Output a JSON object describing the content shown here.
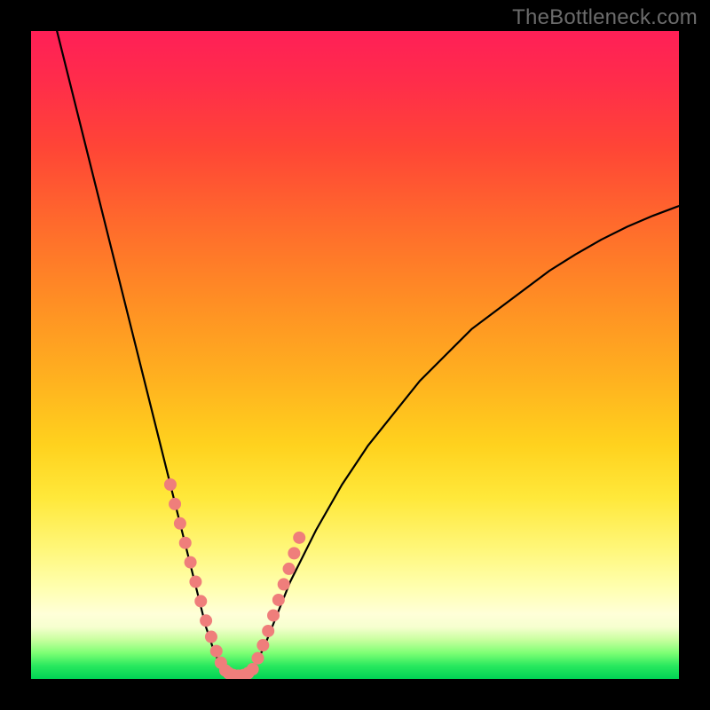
{
  "watermark": {
    "text": "TheBottleneck.com"
  },
  "colors": {
    "curve": "#000000",
    "marker_fill": "#ef7e7b",
    "marker_stroke": "#b24f4e",
    "frame": "#000000"
  },
  "chart_data": {
    "type": "line",
    "title": "",
    "xlabel": "",
    "ylabel": "",
    "xlim": [
      0,
      100
    ],
    "ylim": [
      0,
      100
    ],
    "grid": false,
    "legend": false,
    "series": [
      {
        "name": "bottleneck-curve-left",
        "x": [
          4,
          6,
          8,
          10,
          12,
          14,
          16,
          18,
          20,
          22,
          24,
          26,
          27,
          28,
          29,
          30
        ],
        "y": [
          100,
          92,
          84,
          76,
          68,
          60,
          52,
          44,
          36,
          28,
          20,
          12,
          8,
          5,
          2.5,
          1
        ]
      },
      {
        "name": "bottleneck-curve-floor",
        "x": [
          30,
          31,
          32,
          33,
          34
        ],
        "y": [
          1,
          0.6,
          0.5,
          0.6,
          1
        ]
      },
      {
        "name": "bottleneck-curve-right",
        "x": [
          34,
          36,
          38,
          40,
          44,
          48,
          52,
          56,
          60,
          64,
          68,
          72,
          76,
          80,
          84,
          88,
          92,
          96,
          100
        ],
        "y": [
          1,
          5,
          10,
          15,
          23,
          30,
          36,
          41,
          46,
          50,
          54,
          57,
          60,
          63,
          65.5,
          67.8,
          69.8,
          71.5,
          73
        ]
      }
    ],
    "markers": [
      {
        "name": "left-band",
        "x": [
          21.5,
          22.2,
          23,
          23.8,
          24.6,
          25.4,
          26.2,
          27,
          27.8,
          28.6,
          29.3,
          30
        ],
        "y": [
          30,
          27,
          24,
          21,
          18,
          15,
          12,
          9,
          6.5,
          4.3,
          2.5,
          1.3
        ]
      },
      {
        "name": "floor-band",
        "x": [
          30.5,
          31.2,
          32,
          32.8,
          33.5
        ],
        "y": [
          0.9,
          0.6,
          0.5,
          0.6,
          0.9
        ]
      },
      {
        "name": "right-band",
        "x": [
          34.2,
          35,
          35.8,
          36.6,
          37.4,
          38.2,
          39,
          39.8,
          40.6,
          41.4
        ],
        "y": [
          1.5,
          3.2,
          5.2,
          7.4,
          9.8,
          12.2,
          14.6,
          17,
          19.4,
          21.8
        ]
      }
    ]
  }
}
